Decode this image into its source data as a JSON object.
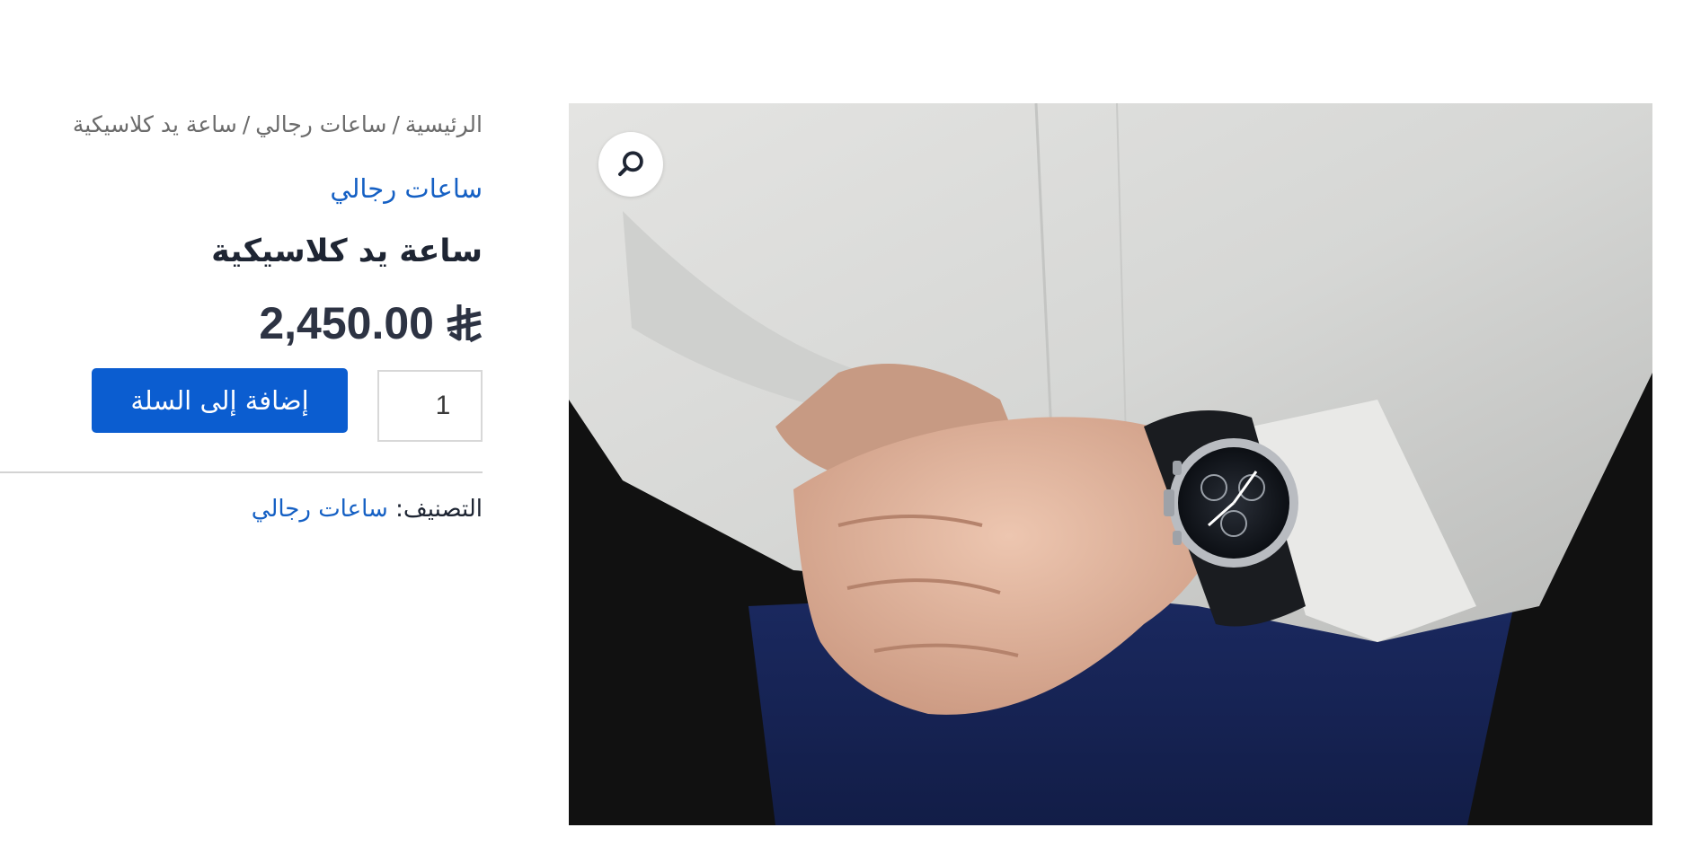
{
  "breadcrumb": {
    "home": "الرئيسية",
    "category": "ساعات رجالي",
    "current": "ساعة يد كلاسيكية",
    "separator": "/"
  },
  "product": {
    "category_link": "ساعات رجالي",
    "title": "ساعة يد كلاسيكية",
    "price": "2,450.00",
    "currency_icon": "saudi-riyal-symbol",
    "quantity": "1",
    "add_to_cart_label": "إضافة إلى السلة",
    "meta_label": "التصنيف:",
    "meta_category": "ساعات رجالي"
  },
  "image": {
    "alt": "man adjusting wristwatch on his wrist",
    "zoom_icon": "search-icon"
  },
  "colors": {
    "accent": "#0b5dd0",
    "link": "#1560c4",
    "text": "#1e2533",
    "muted": "#6b6b6b"
  }
}
